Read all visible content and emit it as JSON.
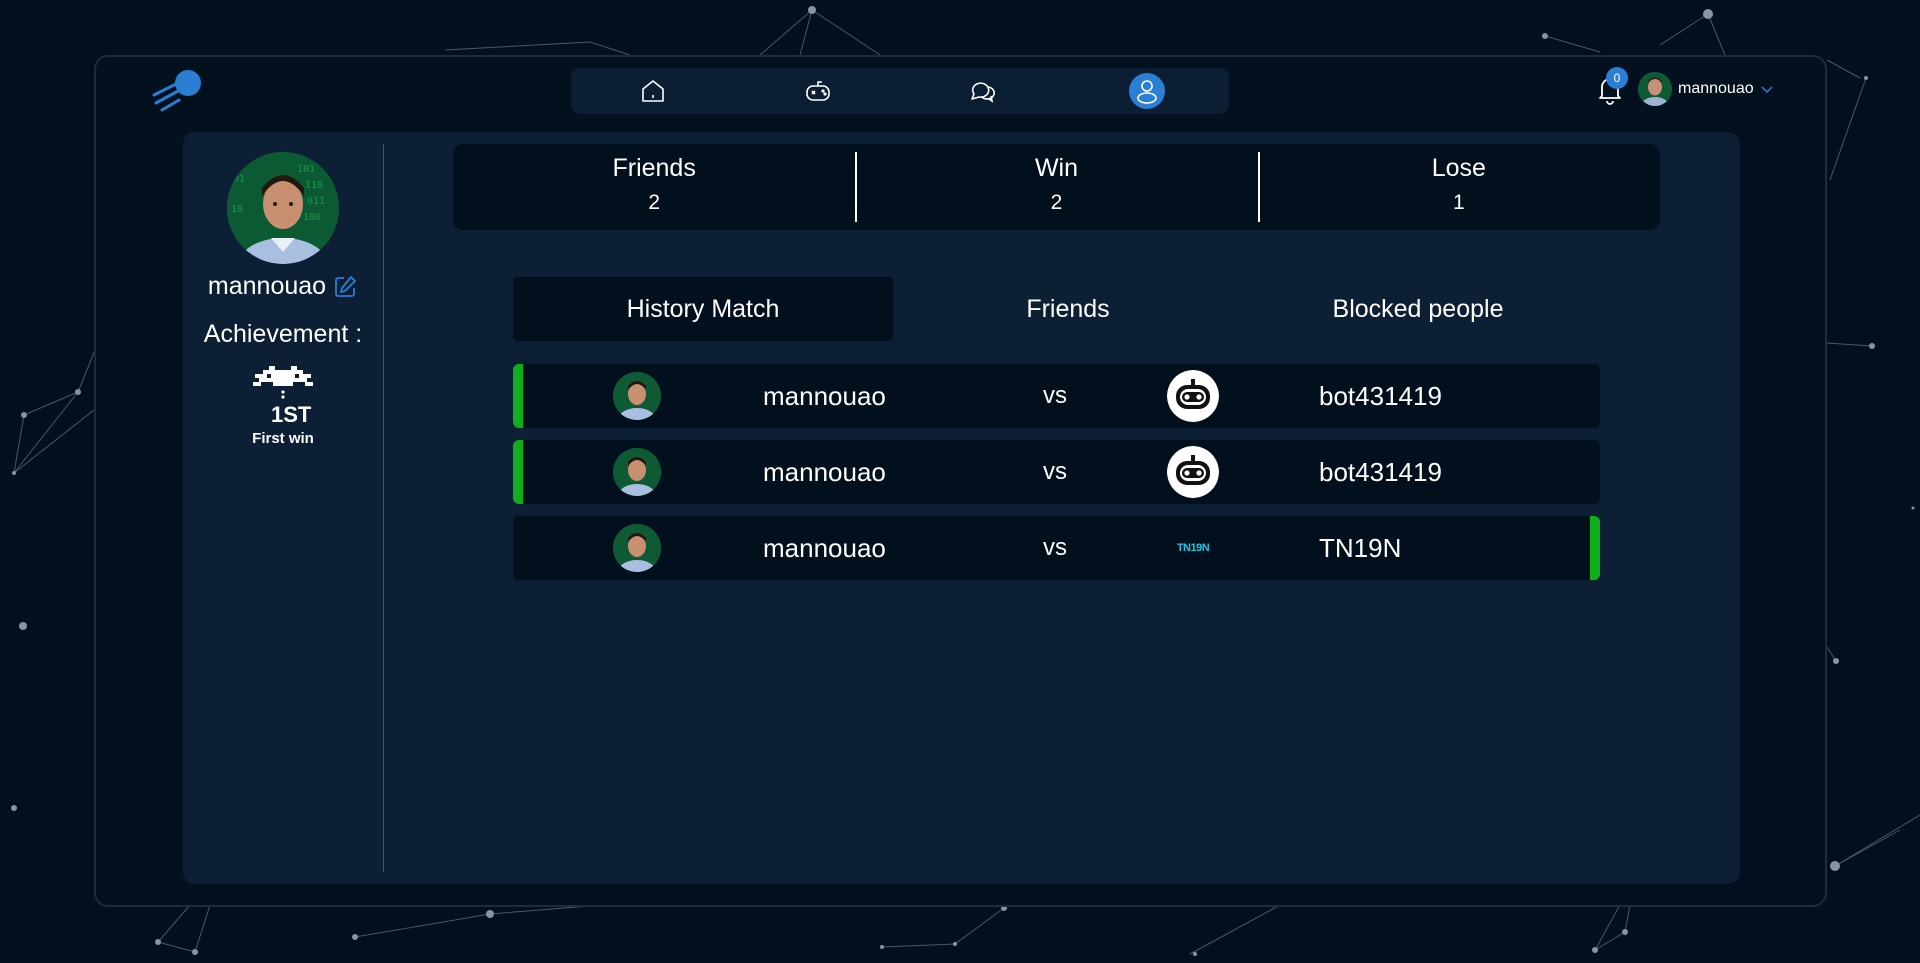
{
  "colors": {
    "background": "#020f1d",
    "panel": "#0d1f35",
    "accent": "#2a7fd4",
    "win": "#0fae1c"
  },
  "nav": {
    "items": [
      {
        "icon": "home-icon",
        "active": false
      },
      {
        "icon": "gamepad-icon",
        "active": false
      },
      {
        "icon": "chat-icon",
        "active": false
      },
      {
        "icon": "profile-icon",
        "active": true
      }
    ]
  },
  "header": {
    "notification_count": "0",
    "username": "mannouao"
  },
  "profile": {
    "username": "mannouao",
    "achievement_title": "Achievement :",
    "achievements": [
      {
        "badge_text": "1ST",
        "label": "First win"
      }
    ]
  },
  "stats": [
    {
      "label": "Friends",
      "value": "2"
    },
    {
      "label": "Win",
      "value": "2"
    },
    {
      "label": "Lose",
      "value": "1"
    }
  ],
  "tabs": [
    {
      "label": "History Match",
      "active": true
    },
    {
      "label": "Friends",
      "active": false
    },
    {
      "label": "Blocked people",
      "active": false
    }
  ],
  "matches": [
    {
      "player": "mannouao",
      "vs": "vs",
      "opponent": "bot431419",
      "opponent_avatar": "robot-icon",
      "winner": "player"
    },
    {
      "player": "mannouao",
      "vs": "vs",
      "opponent": "bot431419",
      "opponent_avatar": "robot-icon",
      "winner": "player"
    },
    {
      "player": "mannouao",
      "vs": "vs",
      "opponent": "TN19N",
      "opponent_avatar": "TN19N",
      "winner": "opponent"
    }
  ]
}
